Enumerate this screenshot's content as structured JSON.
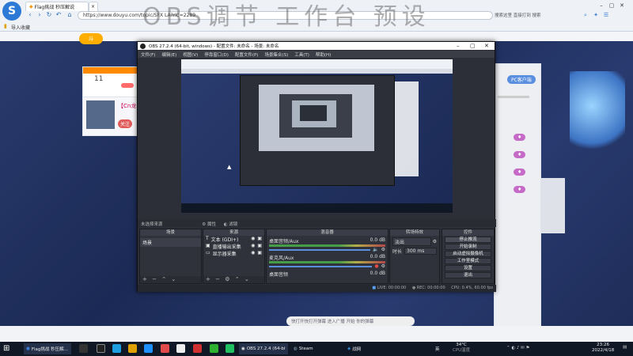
{
  "browser": {
    "tabs": [
      {
        "label": "Flag挑战 秒压解说"
      },
      {
        "label": "×"
      }
    ],
    "address": "https://www.douyu.com/topic/SFX LA?rid=2289",
    "bookmark": "导入收藏",
    "search_hint": "搜索这里 直接打到 搜索",
    "overlay_text": "OBS调节 工作台 预设"
  },
  "douyu": {
    "left_card_count": "11",
    "streamer_tag": "【Cn龙",
    "right_button": "PC客户端",
    "chat_hint": "快打开快打开弹幕 进入广播 开始 你的弹幕"
  },
  "obs": {
    "title": "OBS 27.2.4 (64-bit, windows) - 配置文件: 未命名 - 场景: 未命名",
    "menu": [
      "文件(F)",
      "编辑(E)",
      "视图(V)",
      "停靠窗口(D)",
      "配置文件(P)",
      "场景集合(S)",
      "工具(T)",
      "帮助(H)"
    ],
    "no_source": "未选择来源",
    "props_label": "属性",
    "filters_label": "滤镜",
    "docks": {
      "scenes": "场景",
      "sources": "来源",
      "mixer": "混音器",
      "transitions": "转场特效",
      "controls": "控件"
    },
    "scene_items": [
      "场景"
    ],
    "source_items": [
      {
        "icon": "T",
        "label": "文本 (GDI+)"
      },
      {
        "icon": "▣",
        "label": "直播输出采集"
      },
      {
        "icon": "▭",
        "label": "显示器采集"
      }
    ],
    "mixer": [
      {
        "name": "桌面音频/Aux",
        "db": "0.0 dB"
      },
      {
        "name": "麦克风/Aux",
        "db": "0.0 dB"
      },
      {
        "name": "桌面音频",
        "db": "0.0 dB"
      }
    ],
    "transition": {
      "type": "淡出",
      "duration_label": "时长",
      "duration": "300 ms"
    },
    "controls": [
      "停止推流",
      "开始录制",
      "启动虚拟摄像机",
      "工作室模式",
      "设置",
      "退出"
    ],
    "status": {
      "live": "LIVE: 00:00:00",
      "rec": "REC: 00:00:00",
      "cpu": "CPU: 0.4%, 60.00 fps"
    }
  },
  "taskbar": {
    "items": [
      "Flag挑战 秒压解...",
      "OBS 27.2.4 (64-bit...",
      "Steam",
      "战网"
    ],
    "weather": "34°C",
    "weather_sub": "CPU温度",
    "ime": "英",
    "time": "23:26",
    "date": "2022/4/18"
  },
  "colors": {
    "accent": "#3a7bd5",
    "obs_bg": "#2c2f38",
    "douyu_pink": "#c66ac8"
  }
}
